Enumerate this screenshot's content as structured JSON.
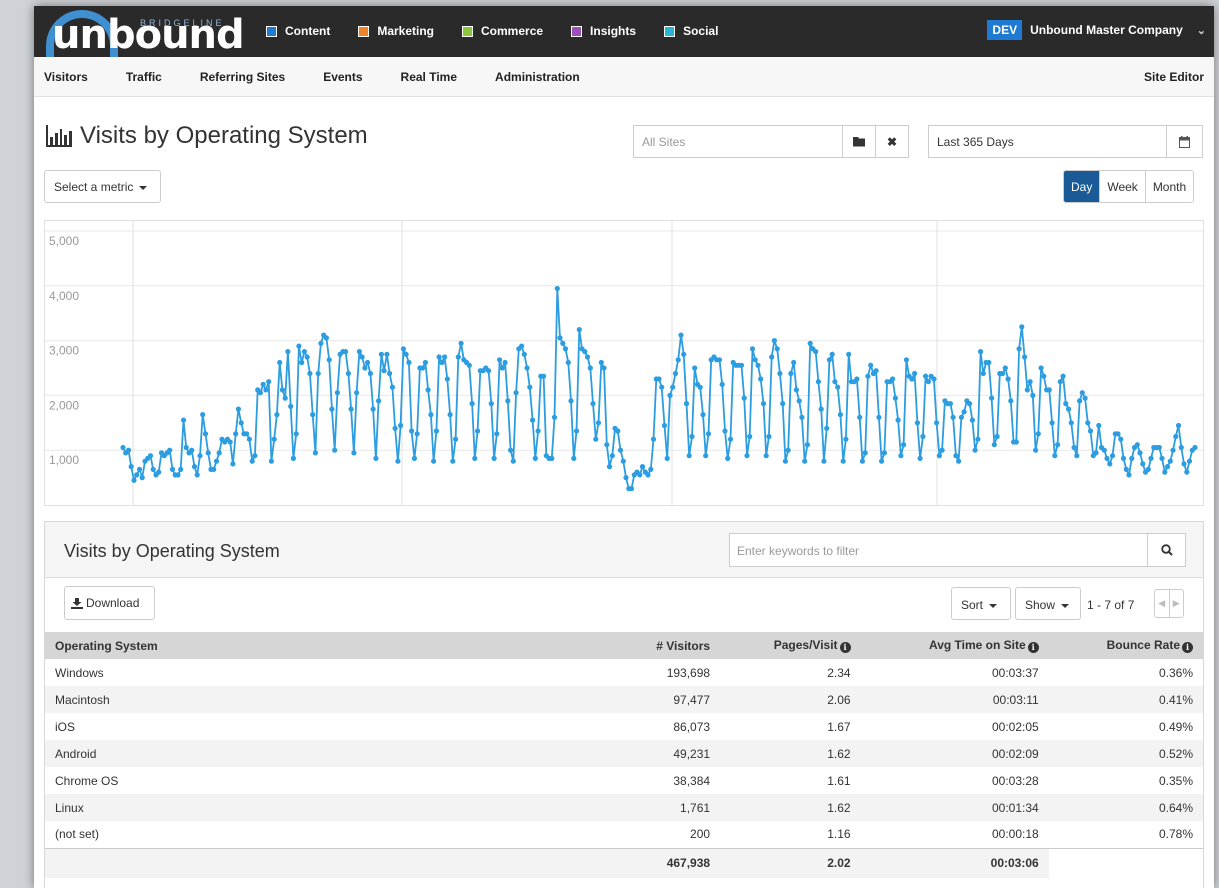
{
  "brand": {
    "logo_text": "unbound",
    "logo_subtext": "BRIDGELINE"
  },
  "top_nav": {
    "modules": [
      {
        "label": "Content",
        "color": "#1e7ad2"
      },
      {
        "label": "Marketing",
        "color": "#f0822a"
      },
      {
        "label": "Commerce",
        "color": "#8cc63f"
      },
      {
        "label": "Insights",
        "color": "#9b4fb7"
      },
      {
        "label": "Social",
        "color": "#29b6d1"
      }
    ],
    "env_badge": "DEV",
    "company": "Unbound Master Company"
  },
  "sub_nav": {
    "items": [
      "Visitors",
      "Traffic",
      "Referring Sites",
      "Events",
      "Real Time",
      "Administration"
    ],
    "site_editor": "Site Editor"
  },
  "page": {
    "title": "Visits by Operating System",
    "site_placeholder": "All Sites",
    "date_range": "Last 365 Days",
    "metric_select": "Select a metric",
    "granularity": [
      "Day",
      "Week",
      "Month"
    ],
    "granularity_active": "Day"
  },
  "chart_data": {
    "type": "line",
    "ylim": [
      0,
      5000
    ],
    "yticks": [
      "1,000",
      "2,000",
      "3,000",
      "4,000",
      "5,000"
    ],
    "grid": true,
    "color": "#2c9de0",
    "values": [
      1050,
      950,
      1000,
      700,
      450,
      550,
      650,
      500,
      800,
      850,
      900,
      650,
      550,
      600,
      950,
      900,
      950,
      1000,
      650,
      550,
      550,
      650,
      1550,
      1050,
      950,
      1000,
      700,
      550,
      900,
      1650,
      1300,
      950,
      650,
      650,
      800,
      950,
      1200,
      1150,
      1200,
      1150,
      750,
      1300,
      1750,
      1500,
      1300,
      1300,
      1200,
      800,
      900,
      2100,
      2050,
      2200,
      2100,
      2250,
      800,
      1200,
      1650,
      2600,
      2100,
      1950,
      2800,
      1800,
      850,
      1300,
      2900,
      2600,
      2800,
      2700,
      2400,
      1650,
      950,
      2400,
      2950,
      3100,
      3050,
      2650,
      1750,
      1000,
      2050,
      2750,
      2800,
      2800,
      2400,
      1750,
      950,
      2050,
      2800,
      2700,
      2500,
      2600,
      2400,
      1750,
      850,
      1900,
      2750,
      2450,
      2750,
      2400,
      2150,
      1400,
      800,
      1450,
      2850,
      2750,
      2600,
      1350,
      850,
      1300,
      2500,
      2500,
      2600,
      2100,
      1650,
      800,
      1350,
      2700,
      2600,
      2700,
      2300,
      1650,
      800,
      1200,
      2700,
      2950,
      2650,
      2600,
      2550,
      1850,
      850,
      1350,
      2450,
      2450,
      2500,
      2450,
      1850,
      850,
      1300,
      2650,
      2500,
      2600,
      1900,
      1000,
      800,
      2050,
      2850,
      2900,
      2750,
      2500,
      2150,
      1550,
      850,
      1350,
      2350,
      2350,
      900,
      850,
      850,
      1600,
      3950,
      3050,
      2950,
      2850,
      2600,
      1900,
      850,
      1350,
      3200,
      2850,
      2800,
      2700,
      2500,
      1850,
      1200,
      1500,
      2600,
      2500,
      1100,
      700,
      900,
      1400,
      1350,
      1000,
      800,
      500,
      300,
      300,
      550,
      600,
      550,
      700,
      600,
      550,
      650,
      1200,
      2300,
      2300,
      2150,
      1450,
      850,
      2000,
      2150,
      2400,
      2650,
      3100,
      2750,
      1850,
      900,
      1250,
      2500,
      2200,
      2150,
      1650,
      900,
      1300,
      2650,
      2700,
      2650,
      2650,
      2200,
      1350,
      850,
      1200,
      2600,
      2550,
      2550,
      2550,
      1950,
      900,
      1250,
      2850,
      2650,
      2550,
      2300,
      1850,
      900,
      1250,
      2700,
      3000,
      2850,
      2400,
      1850,
      800,
      1000,
      2400,
      2600,
      2100,
      1900,
      1600,
      800,
      1100,
      2950,
      2850,
      2800,
      2250,
      1750,
      800,
      1400,
      2650,
      2750,
      2250,
      2150,
      1650,
      800,
      1200,
      2750,
      2250,
      2250,
      2300,
      1600,
      800,
      950,
      2350,
      2550,
      2400,
      2450,
      1600,
      800,
      950,
      2250,
      2250,
      2300,
      1950,
      1550,
      900,
      1100,
      2650,
      2350,
      2300,
      2400,
      1500,
      850,
      1250,
      2350,
      2250,
      2350,
      2300,
      1500,
      900,
      1000,
      1900,
      1850,
      1850,
      1600,
      900,
      800,
      1600,
      1700,
      1900,
      1850,
      1550,
      1000,
      1200,
      2800,
      2400,
      2600,
      2600,
      1950,
      1100,
      1250,
      2400,
      2400,
      2500,
      2300,
      1900,
      1150,
      1150,
      2850,
      3250,
      2700,
      2100,
      2250,
      2000,
      1000,
      1300,
      2500,
      2350,
      2100,
      2100,
      1500,
      900,
      1100,
      2250,
      2350,
      1850,
      1750,
      1500,
      1050,
      900,
      1900,
      2050,
      1950,
      1500,
      1350,
      900,
      950,
      1450,
      1050,
      1000,
      850,
      750,
      900,
      1300,
      1300,
      1200,
      850,
      650,
      550,
      850,
      1050,
      1100,
      950,
      750,
      600,
      650,
      850,
      1050,
      1050,
      1050,
      850,
      600,
      700,
      800,
      1000,
      1250,
      1450,
      1050,
      750,
      600,
      800,
      1000,
      1050
    ]
  },
  "table_panel": {
    "title": "Visits by Operating System",
    "filter_placeholder": "Enter keywords to filter",
    "download_label": "Download",
    "sort_label": "Sort",
    "show_label": "Show",
    "pager_text": "1 - 7 of 7",
    "columns": [
      "Operating System",
      "# Visitors",
      "Pages/Visit",
      "Avg Time on Site",
      "Bounce Rate"
    ],
    "rows": [
      [
        "Windows",
        "193,698",
        "2.34",
        "00:03:37",
        "0.36%"
      ],
      [
        "Macintosh",
        "97,477",
        "2.06",
        "00:03:11",
        "0.41%"
      ],
      [
        "iOS",
        "86,073",
        "1.67",
        "00:02:05",
        "0.49%"
      ],
      [
        "Android",
        "49,231",
        "1.62",
        "00:02:09",
        "0.52%"
      ],
      [
        "Chrome OS",
        "38,384",
        "1.61",
        "00:03:28",
        "0.35%"
      ],
      [
        "Linux",
        "1,761",
        "1.62",
        "00:01:34",
        "0.64%"
      ],
      [
        "(not set)",
        "200",
        "1.16",
        "00:00:18",
        "0.78%"
      ]
    ],
    "totals": [
      "",
      "467,938",
      "2.02",
      "00:03:06",
      ""
    ]
  }
}
